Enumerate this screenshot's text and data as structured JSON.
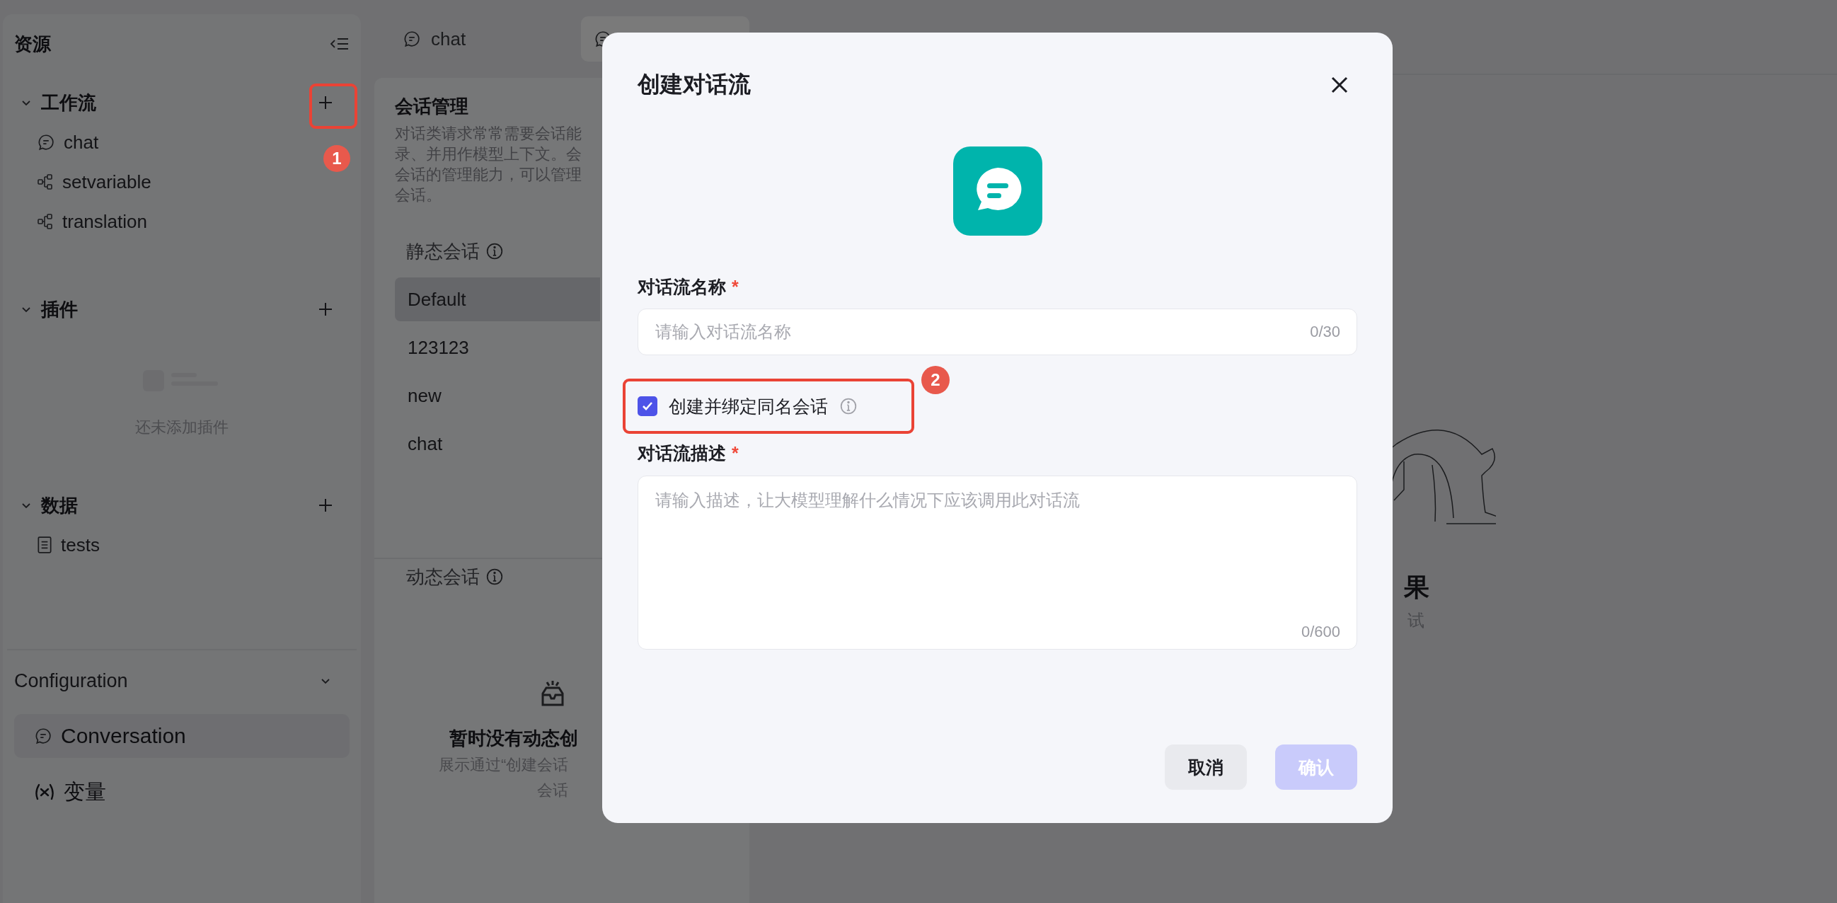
{
  "sidebar": {
    "title": "资源",
    "sections": [
      {
        "label": "工作流",
        "expanded": true,
        "items": [
          {
            "label": "chat",
            "kind": "chat"
          },
          {
            "label": "setvariable",
            "kind": "workflow"
          },
          {
            "label": "translation",
            "kind": "workflow"
          }
        ]
      },
      {
        "label": "插件",
        "expanded": true,
        "empty_text": "还未添加插件"
      },
      {
        "label": "数据",
        "expanded": true,
        "items": [
          {
            "label": "tests",
            "kind": "document"
          }
        ]
      }
    ],
    "configuration": {
      "label": "Configuration",
      "expanded": true,
      "items": [
        {
          "label": "Conversation",
          "kind": "chat",
          "selected": true
        },
        {
          "label": "变量",
          "kind": "variable",
          "selected": false
        }
      ]
    }
  },
  "tabs": [
    {
      "label": "chat",
      "selected": false
    },
    {
      "selected": true
    }
  ],
  "conversation_panel": {
    "title": "会话管理",
    "description_lines": [
      "对话类请求常常需要会话能",
      "录、并用作模型上下文。会",
      "会话的管理能力，可以管理",
      "会话。"
    ],
    "static": {
      "label": "静态会话",
      "items": [
        {
          "label": "Default",
          "selected": true
        },
        {
          "label": "123123",
          "selected": false
        },
        {
          "label": "new",
          "selected": false
        },
        {
          "label": "chat",
          "selected": false
        }
      ]
    },
    "dynamic": {
      "label": "动态会话",
      "empty_title": "暂时没有动态创",
      "empty_lines": [
        "展示通过“创建会话",
        "会话"
      ]
    }
  },
  "main_area": {
    "result_title": "果",
    "result_hint": "试"
  },
  "dialog": {
    "title": "创建对话流",
    "name_field": {
      "label": "对话流名称",
      "required_mark": "*",
      "placeholder": "请输入对话流名称",
      "counter": "0/30"
    },
    "bind_option": {
      "label": "创建并绑定同名会话",
      "checked": true
    },
    "description_field": {
      "label": "对话流描述",
      "required_mark": "*",
      "placeholder": "请输入描述，让大模型理解什么情况下应该调用此对话流",
      "counter": "0/600"
    },
    "buttons": [
      {
        "label": "取消",
        "kind": "secondary",
        "disabled": false
      },
      {
        "label": "确认",
        "kind": "primary",
        "disabled": true
      }
    ]
  },
  "annotations": [
    {
      "number": "1"
    },
    {
      "number": "2"
    }
  ]
}
